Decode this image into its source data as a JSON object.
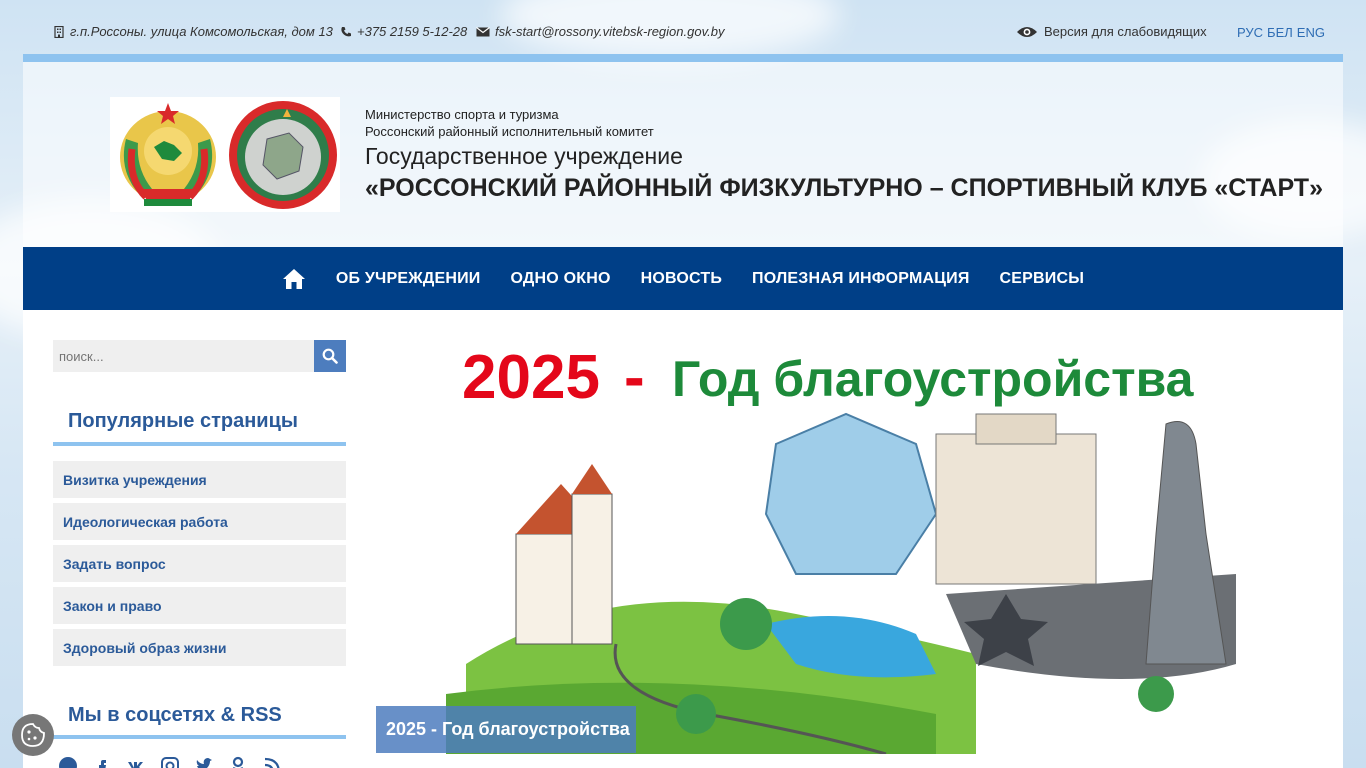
{
  "topbar": {
    "address": "г.п.Россоны. улица Комсомольская, дом 13",
    "phone": "+375 2159 5-12-28",
    "email": "fsk-start@rossony.vitebsk-region.gov.by",
    "vision_label": "Версия для слабовидящих",
    "languages": [
      "РУС",
      "БЕЛ",
      "ENG"
    ]
  },
  "header": {
    "line1": "Министерство спорта и туризма",
    "line2": "Россонский районный исполнительный комитет",
    "line3": "Государственное учреждение",
    "line4": "«РОССОНСКИЙ РАЙОННЫЙ ФИЗКУЛЬТУРНО – СПОРТИВНЫЙ КЛУБ «СТАРТ»"
  },
  "nav": {
    "items": [
      "ОБ УЧРЕЖДЕНИИ",
      "ОДНО ОКНО",
      "НОВОСТЬ",
      "ПОЛЕЗНАЯ ИНФОРМАЦИЯ",
      "СЕРВИСЫ"
    ]
  },
  "sidebar": {
    "search_placeholder": "поиск...",
    "popular_title": "Популярные страницы",
    "popular_items": [
      "Визитка учреждения",
      "Идеологическая работа",
      "Задать вопрос",
      "Закон и право",
      "Здоровый образ жизни"
    ],
    "social_title": "Мы в соцсетях & RSS",
    "social_icons": [
      "website-icon",
      "facebook-icon",
      "vk-icon",
      "instagram-icon",
      "twitter-icon",
      "odnoklassniki-icon",
      "rss-icon"
    ]
  },
  "banner": {
    "year": "2025",
    "dash": "-",
    "headline": "Год благоустройства",
    "caption": "2025 - Год благоустройства"
  },
  "colors": {
    "nav_bg": "#003f87",
    "accent_blue": "#8ec3ef",
    "link_blue": "#2b5a99",
    "banner_red": "#e4071a",
    "banner_green": "#1d8a3a"
  }
}
